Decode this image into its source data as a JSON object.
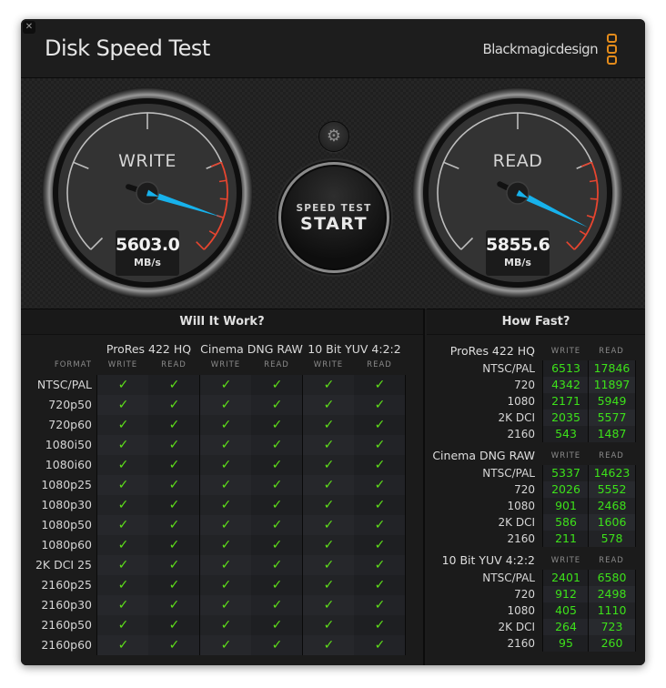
{
  "window": {
    "title": "Disk Speed Test",
    "brand": "Blackmagicdesign",
    "close_icon": "close-icon",
    "brand_color": "#e38b1b"
  },
  "gauges": {
    "write": {
      "label": "WRITE",
      "value": "5603.0",
      "unit": "MB/s",
      "needle_fraction": 0.9
    },
    "read": {
      "label": "READ",
      "value": "5855.6",
      "unit": "MB/s",
      "needle_fraction": 0.93
    },
    "needle_color": "#17b2ec",
    "redline_color": "#e8452f"
  },
  "controls": {
    "settings_icon": "gear-icon",
    "start_sub": "SPEED TEST",
    "start_main": "START"
  },
  "will_it_work": {
    "title": "Will It Work?",
    "format_label": "FORMAT",
    "codecs": [
      "ProRes 422 HQ",
      "Cinema DNG RAW",
      "10 Bit YUV 4:2:2"
    ],
    "sub_labels": [
      "WRITE",
      "READ"
    ],
    "check_glyph": "✓",
    "check_color": "#5fe01a",
    "rows": [
      {
        "format": "NTSC/PAL",
        "results": [
          true,
          true,
          true,
          true,
          true,
          true
        ]
      },
      {
        "format": "720p50",
        "results": [
          true,
          true,
          true,
          true,
          true,
          true
        ]
      },
      {
        "format": "720p60",
        "results": [
          true,
          true,
          true,
          true,
          true,
          true
        ]
      },
      {
        "format": "1080i50",
        "results": [
          true,
          true,
          true,
          true,
          true,
          true
        ]
      },
      {
        "format": "1080i60",
        "results": [
          true,
          true,
          true,
          true,
          true,
          true
        ]
      },
      {
        "format": "1080p25",
        "results": [
          true,
          true,
          true,
          true,
          true,
          true
        ]
      },
      {
        "format": "1080p30",
        "results": [
          true,
          true,
          true,
          true,
          true,
          true
        ]
      },
      {
        "format": "1080p50",
        "results": [
          true,
          true,
          true,
          true,
          true,
          true
        ]
      },
      {
        "format": "1080p60",
        "results": [
          true,
          true,
          true,
          true,
          true,
          true
        ]
      },
      {
        "format": "2K DCI 25",
        "results": [
          true,
          true,
          true,
          true,
          true,
          true
        ]
      },
      {
        "format": "2160p25",
        "results": [
          true,
          true,
          true,
          true,
          true,
          true
        ]
      },
      {
        "format": "2160p30",
        "results": [
          true,
          true,
          true,
          true,
          true,
          true
        ]
      },
      {
        "format": "2160p50",
        "results": [
          true,
          true,
          true,
          true,
          true,
          true
        ]
      },
      {
        "format": "2160p60",
        "results": [
          true,
          true,
          true,
          true,
          true,
          true
        ]
      }
    ]
  },
  "how_fast": {
    "title": "How Fast?",
    "write_label": "WRITE",
    "read_label": "READ",
    "sections": [
      {
        "codec": "ProRes 422 HQ",
        "rows": [
          {
            "format": "NTSC/PAL",
            "write": "6513",
            "read": "17846"
          },
          {
            "format": "720",
            "write": "4342",
            "read": "11897"
          },
          {
            "format": "1080",
            "write": "2171",
            "read": "5949"
          },
          {
            "format": "2K DCI",
            "write": "2035",
            "read": "5577"
          },
          {
            "format": "2160",
            "write": "543",
            "read": "1487"
          }
        ]
      },
      {
        "codec": "Cinema DNG RAW",
        "rows": [
          {
            "format": "NTSC/PAL",
            "write": "5337",
            "read": "14623"
          },
          {
            "format": "720",
            "write": "2026",
            "read": "5552"
          },
          {
            "format": "1080",
            "write": "901",
            "read": "2468"
          },
          {
            "format": "2K DCI",
            "write": "586",
            "read": "1606"
          },
          {
            "format": "2160",
            "write": "211",
            "read": "578"
          }
        ]
      },
      {
        "codec": "10 Bit YUV 4:2:2",
        "rows": [
          {
            "format": "NTSC/PAL",
            "write": "2401",
            "read": "6580"
          },
          {
            "format": "720",
            "write": "912",
            "read": "2498"
          },
          {
            "format": "1080",
            "write": "405",
            "read": "1110"
          },
          {
            "format": "2K DCI",
            "write": "264",
            "read": "723"
          },
          {
            "format": "2160",
            "write": "95",
            "read": "260"
          }
        ]
      }
    ]
  }
}
